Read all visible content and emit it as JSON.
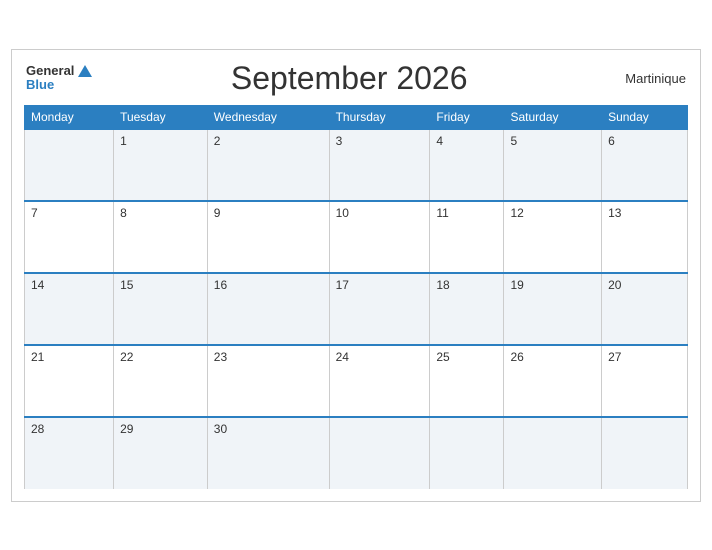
{
  "header": {
    "logo_general": "General",
    "logo_blue": "Blue",
    "title": "September 2026",
    "region": "Martinique"
  },
  "days": [
    "Monday",
    "Tuesday",
    "Wednesday",
    "Thursday",
    "Friday",
    "Saturday",
    "Sunday"
  ],
  "weeks": [
    [
      "",
      "1",
      "2",
      "3",
      "4",
      "5",
      "6"
    ],
    [
      "7",
      "8",
      "9",
      "10",
      "11",
      "12",
      "13"
    ],
    [
      "14",
      "15",
      "16",
      "17",
      "18",
      "19",
      "20"
    ],
    [
      "21",
      "22",
      "23",
      "24",
      "25",
      "26",
      "27"
    ],
    [
      "28",
      "29",
      "30",
      "",
      "",
      "",
      ""
    ]
  ]
}
